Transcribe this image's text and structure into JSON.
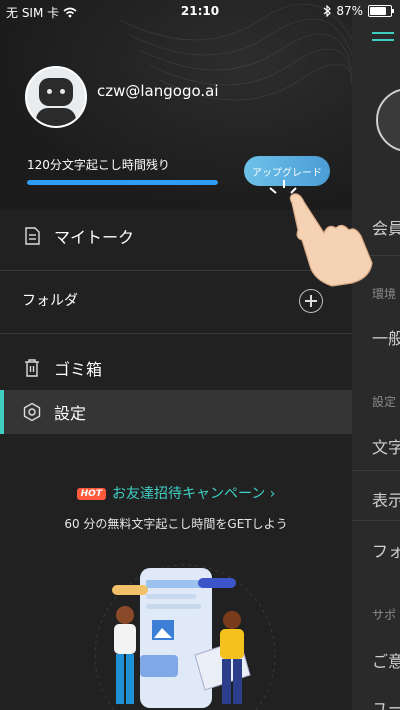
{
  "status_bar": {
    "carrier": "无 SIM 卡",
    "time": "21:10",
    "battery": "87%",
    "battery_level": 0.87
  },
  "profile": {
    "email": "czw@langogo.ai",
    "remaining_text": "120分文字起こし時間残り",
    "progress": 1.0,
    "upgrade_label": "アップグレード"
  },
  "menu": {
    "my_talk": "マイトーク",
    "folder": "フォルダ",
    "trash": "ゴミ箱",
    "settings": "設定"
  },
  "invite": {
    "badge": "HOT",
    "title": "お友達招待キャンペーン",
    "subtitle": "60 分の無料文字起こし時間をGETしよう"
  },
  "background_page": {
    "rows": [
      "会員",
      "環境",
      "一般",
      "設定",
      "文字",
      "表示",
      "フォ",
      "サポ",
      "ご意",
      "ユー"
    ]
  },
  "colors": {
    "accent": "#3ecfc2",
    "progress": "#2f9df5",
    "upgrade": "#5fb3e2",
    "hot": "#ff5a3c"
  }
}
